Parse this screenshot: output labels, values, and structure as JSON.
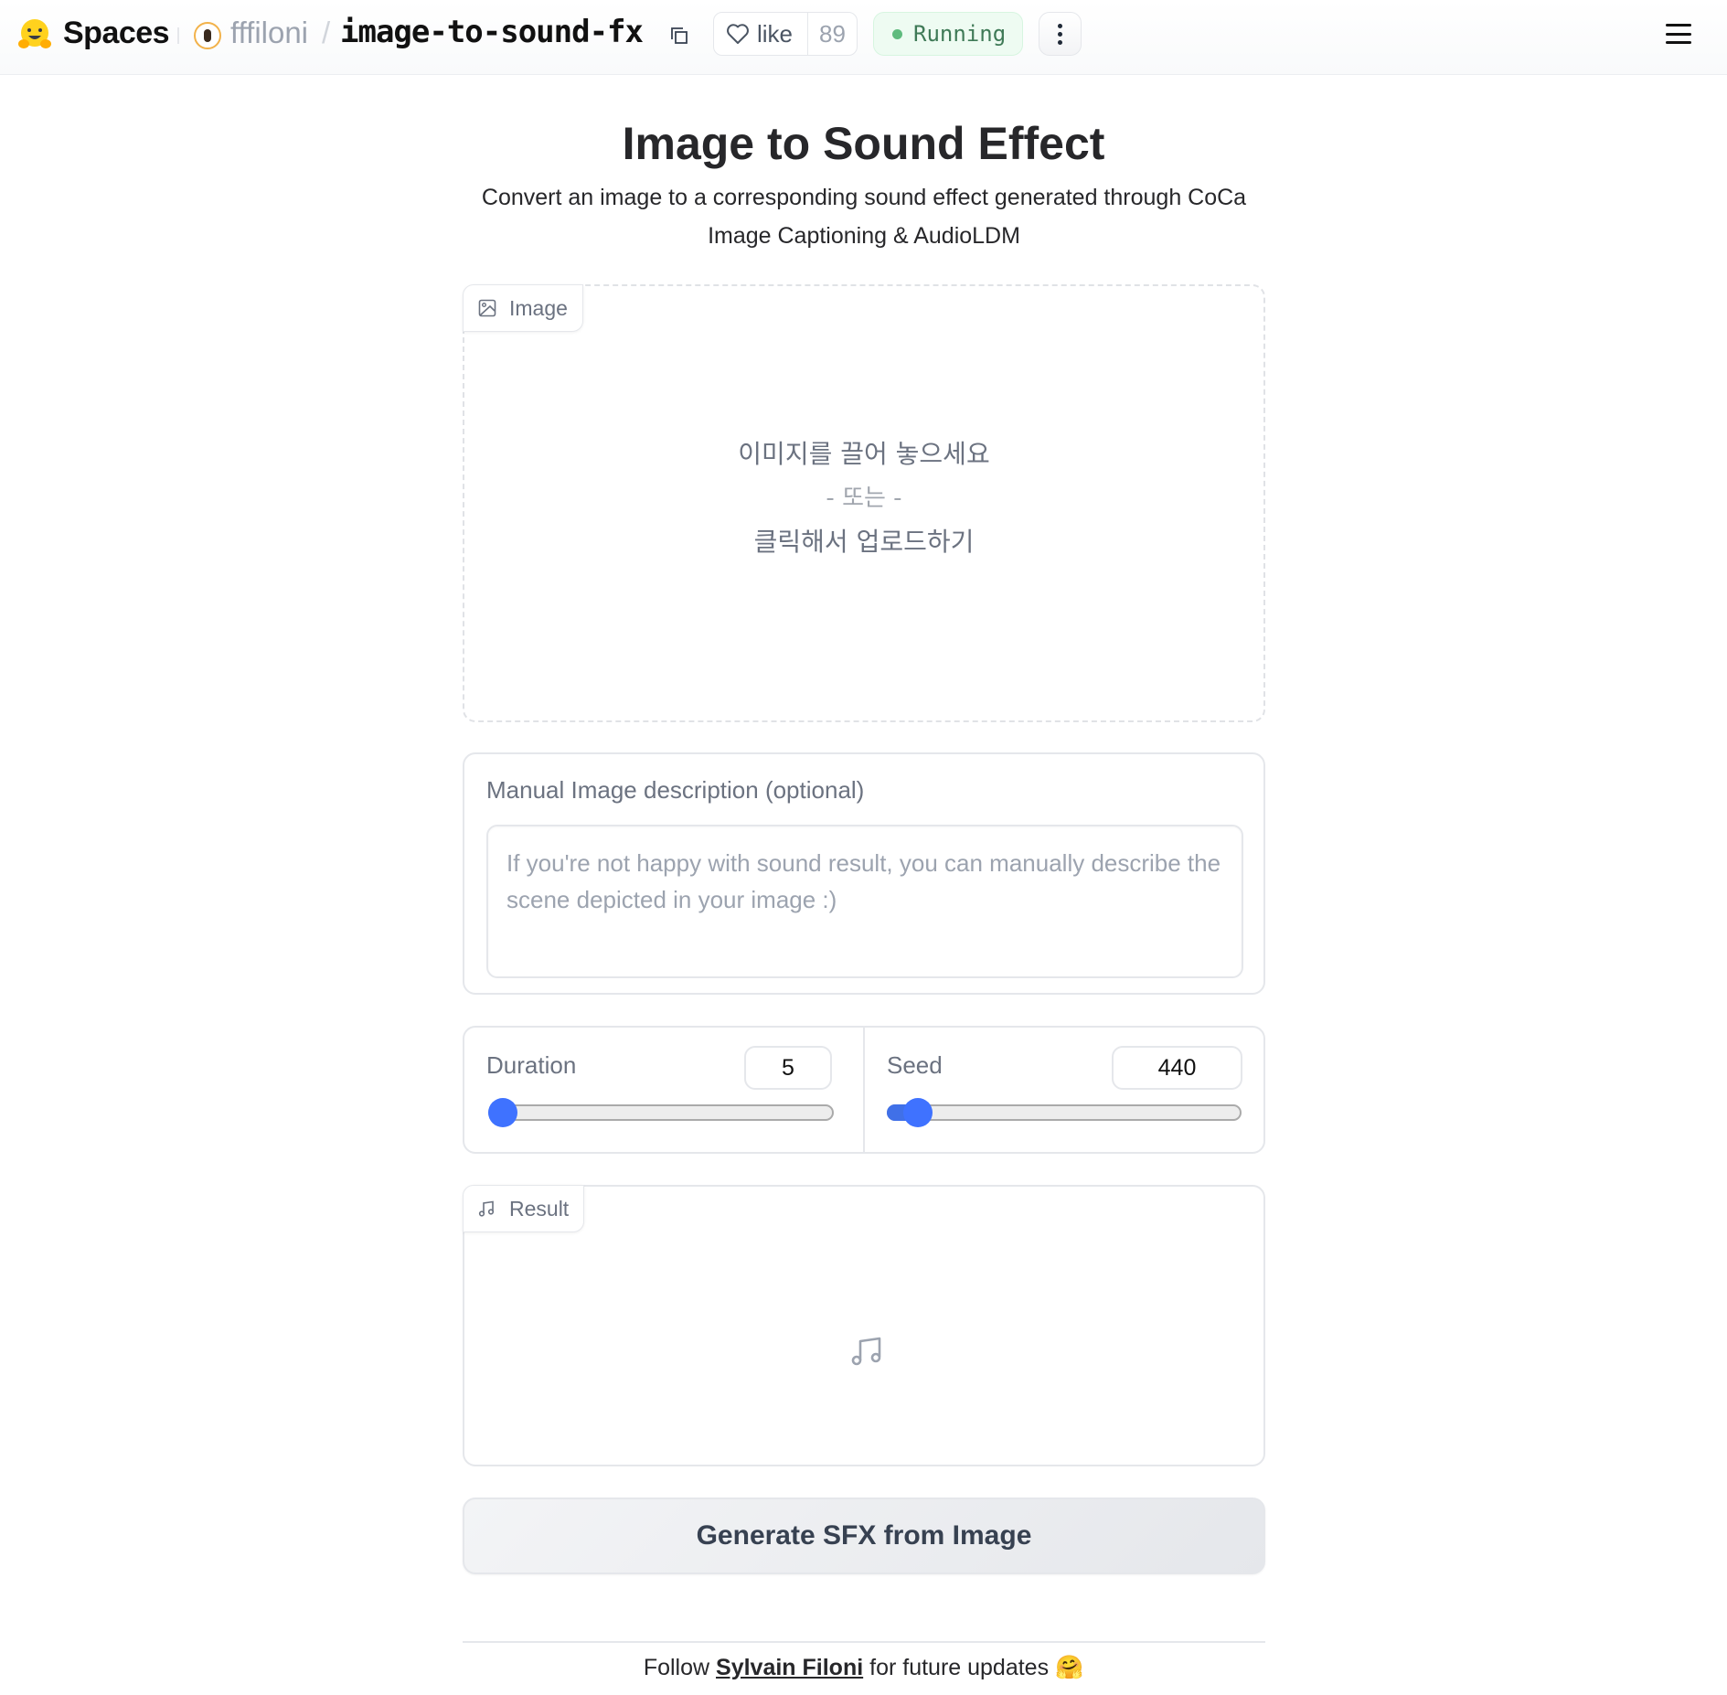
{
  "header": {
    "brand": "Spaces",
    "owner": "fffiloni",
    "separator": "/",
    "repo": "image-to-sound-fx",
    "like_label": "like",
    "like_count": "89",
    "status": "Running",
    "colors": {
      "status_bg": "#eefbf2",
      "status_dot": "#5fbb7e",
      "status_text": "#3f7a57"
    }
  },
  "main": {
    "title": "Image to Sound Effect",
    "subtitle": "Convert an image to a corresponding sound effect generated through CoCa Image Captioning & AudioLDM",
    "image_input": {
      "label": "Image",
      "drop_text": "이미지를 끌어 놓으세요",
      "or_text": "- 또는 -",
      "click_text": "클릭해서 업로드하기"
    },
    "description": {
      "label": "Manual Image description (optional)",
      "value": "",
      "placeholder": "If you're not happy with sound result, you can manually describe the scene depicted in your image :)"
    },
    "duration": {
      "label": "Duration",
      "value": "5",
      "fraction": 0.0
    },
    "seed": {
      "label": "Seed",
      "value": "440",
      "fraction": 0.05
    },
    "result": {
      "label": "Result"
    },
    "generate_button": "Generate SFX from Image",
    "accent_color": "#3f72ff"
  },
  "footer": {
    "prefix": "Follow",
    "link": "Sylvain Filoni",
    "suffix": "for future updates",
    "emoji": "🤗"
  }
}
